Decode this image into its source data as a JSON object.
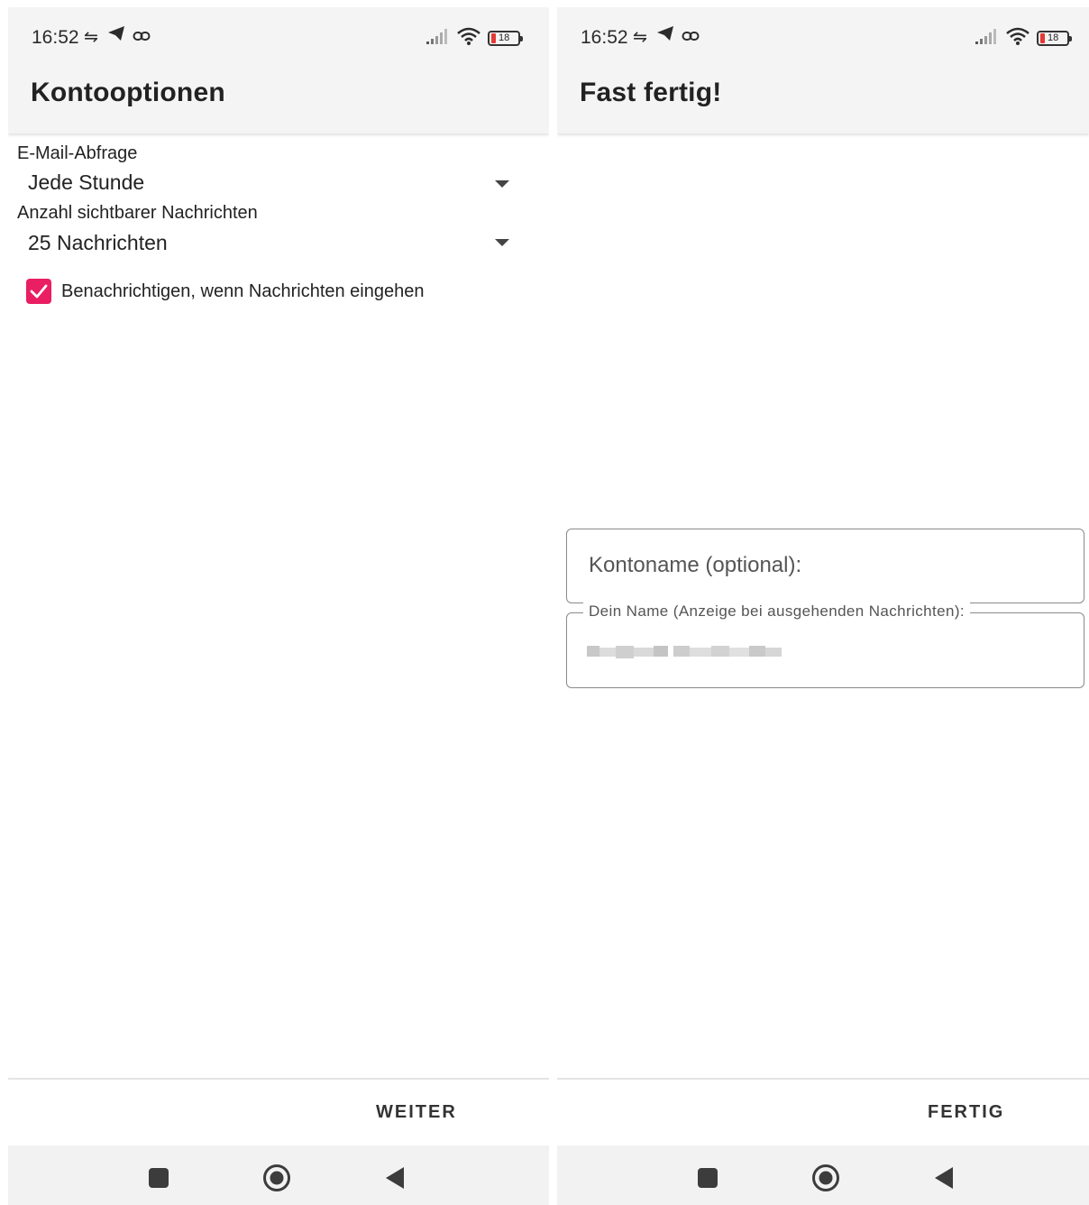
{
  "left": {
    "status": {
      "time": "16:52",
      "battery": "18"
    },
    "title": "Kontooptionen",
    "poll_label": "E-Mail-Abfrage",
    "poll_value": "Jede Stunde",
    "count_label": "Anzahl sichtbarer Nachrichten",
    "count_value": "25 Nachrichten",
    "notify_label": "Benachrichtigen, wenn Nachrichten eingehen",
    "notify_checked": true,
    "next_button": "WEITER"
  },
  "right": {
    "status": {
      "time": "16:52",
      "battery": "18"
    },
    "title": "Fast fertig!",
    "account_name_placeholder": "Kontoname (optional):",
    "your_name_label": "Dein Name (Anzeige bei ausgehenden Nachrichten):",
    "done_button": "FERTIG"
  },
  "icons": {
    "status_bar": [
      "data-transfer-icon",
      "telegram-icon",
      "link-icon",
      "signal-icon",
      "wifi-icon",
      "battery-icon"
    ],
    "nav_bar": [
      "recents-square-icon",
      "home-circle-icon",
      "back-triangle-icon"
    ]
  },
  "colors": {
    "accent": "#e91e63",
    "battery_low": "#e53935",
    "appbar": "#f4f4f4"
  }
}
